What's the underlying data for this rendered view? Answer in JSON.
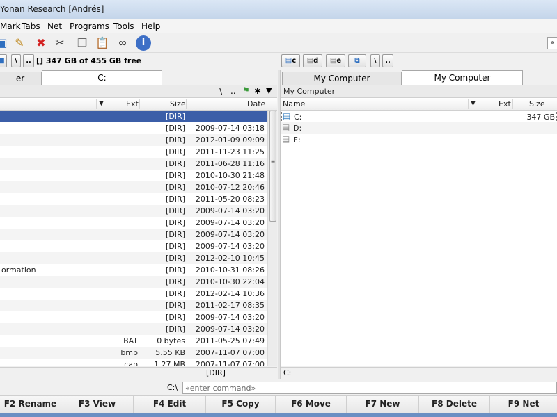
{
  "window": {
    "title": "Yonan Research [Andrés]"
  },
  "menu": [
    "Mark",
    "Tabs",
    "Net",
    "Programs",
    "Tools",
    "Help"
  ],
  "left": {
    "free_space": "[] 347 GB of 455 GB free",
    "tabs": [
      "er",
      "C:"
    ],
    "path_tools": [
      "\\",
      "..",
      "✱"
    ],
    "columns": {
      "ext": "Ext",
      "size": "Size",
      "date": "Date"
    },
    "rows": [
      {
        "name": "",
        "ext": "",
        "size": "[DIR]",
        "date": ""
      },
      {
        "name": "",
        "ext": "",
        "size": "[DIR]",
        "date": "2009-07-14 03:18"
      },
      {
        "name": "",
        "ext": "",
        "size": "[DIR]",
        "date": "2012-01-09 09:09"
      },
      {
        "name": "",
        "ext": "",
        "size": "[DIR]",
        "date": "2011-11-23 11:25"
      },
      {
        "name": "",
        "ext": "",
        "size": "[DIR]",
        "date": "2011-06-28 11:16"
      },
      {
        "name": "",
        "ext": "",
        "size": "[DIR]",
        "date": "2010-10-30 21:48"
      },
      {
        "name": "",
        "ext": "",
        "size": "[DIR]",
        "date": "2010-07-12 20:46"
      },
      {
        "name": "",
        "ext": "",
        "size": "[DIR]",
        "date": "2011-05-20 08:23"
      },
      {
        "name": "",
        "ext": "",
        "size": "[DIR]",
        "date": "2009-07-14 03:20"
      },
      {
        "name": "",
        "ext": "",
        "size": "[DIR]",
        "date": "2009-07-14 03:20"
      },
      {
        "name": "",
        "ext": "",
        "size": "[DIR]",
        "date": "2009-07-14 03:20"
      },
      {
        "name": "",
        "ext": "",
        "size": "[DIR]",
        "date": "2009-07-14 03:20"
      },
      {
        "name": "",
        "ext": "",
        "size": "[DIR]",
        "date": "2012-02-10 10:45"
      },
      {
        "name": "ormation",
        "ext": "",
        "size": "[DIR]",
        "date": "2010-10-31 08:26"
      },
      {
        "name": "",
        "ext": "",
        "size": "[DIR]",
        "date": "2010-10-30 22:04"
      },
      {
        "name": "",
        "ext": "",
        "size": "[DIR]",
        "date": "2012-02-14 10:36"
      },
      {
        "name": "",
        "ext": "",
        "size": "[DIR]",
        "date": "2011-02-17 08:35"
      },
      {
        "name": "",
        "ext": "",
        "size": "[DIR]",
        "date": "2009-07-14 03:20"
      },
      {
        "name": "",
        "ext": "",
        "size": "[DIR]",
        "date": "2009-07-14 03:20"
      },
      {
        "name": "",
        "ext": "BAT",
        "size": "0 bytes",
        "date": "2011-05-25 07:49"
      },
      {
        "name": "",
        "ext": "bmp",
        "size": "5.55 KB",
        "date": "2007-11-07 07:00"
      },
      {
        "name": "",
        "ext": "cab",
        "size": "1.27 MB",
        "date": "2007-11-07 07:00"
      }
    ],
    "status": "[DIR]"
  },
  "right": {
    "drive_buttons": [
      "c",
      "d",
      "e",
      "\\",
      ".."
    ],
    "tabs": [
      "My Computer",
      "My Computer"
    ],
    "path": "My Computer",
    "columns": {
      "name": "Name",
      "ext": "Ext",
      "size": "Size"
    },
    "rows": [
      {
        "name": "C:",
        "size": "347 GB"
      },
      {
        "name": "D:",
        "size": ""
      },
      {
        "name": "E:",
        "size": ""
      }
    ],
    "status": "C:"
  },
  "command": {
    "label": "C:\\",
    "placeholder": "«enter command»"
  },
  "fkeys": [
    "F2 Rename",
    "F3 View",
    "F4 Edit",
    "F5 Copy",
    "F6 Move",
    "F7 New",
    "F8 Delete",
    "F9 Net"
  ],
  "colors": {
    "selection": "#3b5ea8",
    "accent": "#6b8fc3"
  }
}
